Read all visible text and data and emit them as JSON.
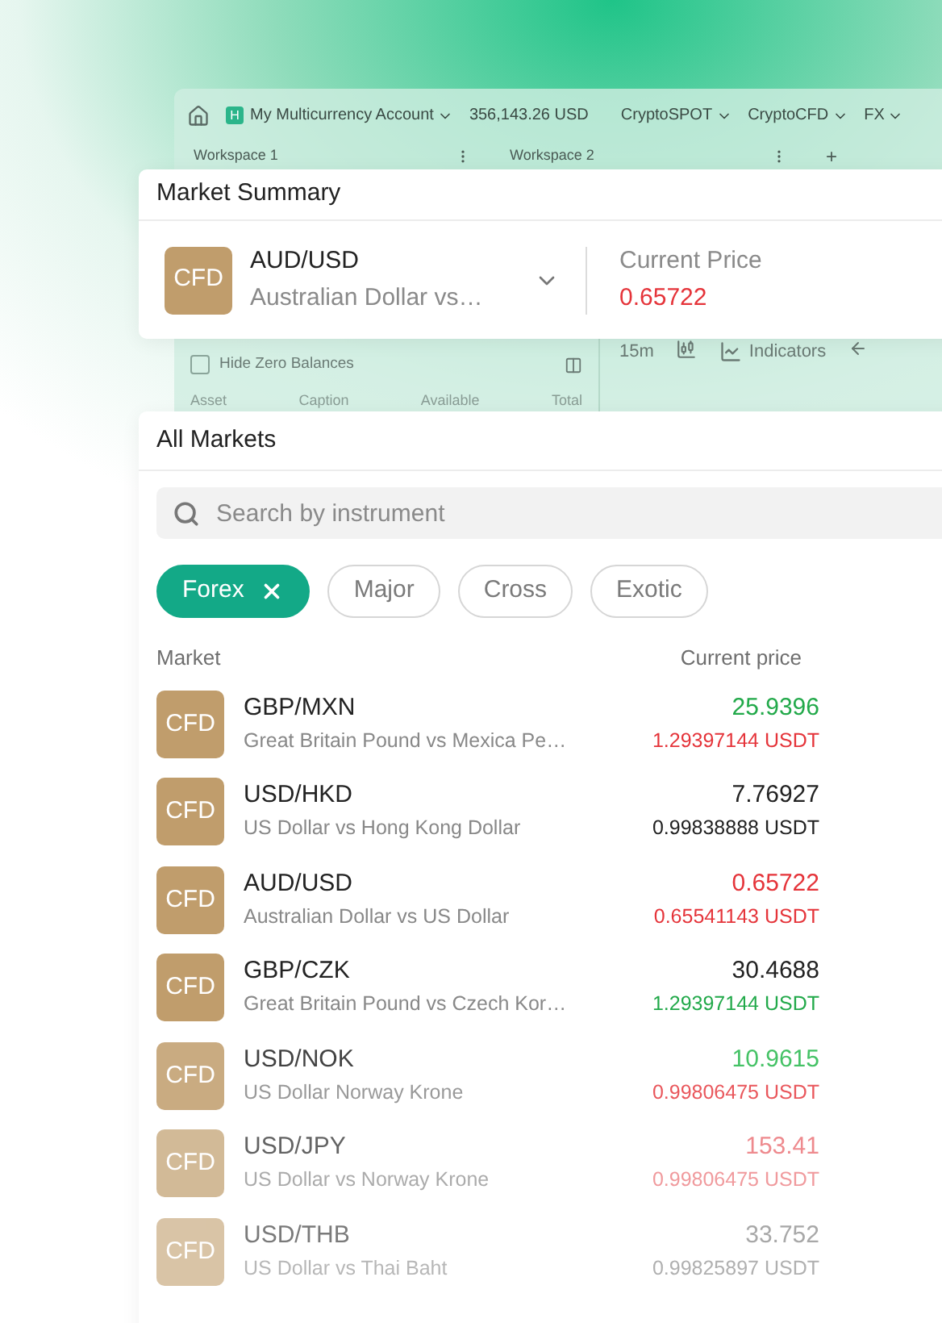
{
  "app_toolbar": {
    "account_badge": "H",
    "account": "My Multicurrency Account",
    "balance": "356,143.26 USD",
    "menus": [
      "CryptoSPOT",
      "CryptoCFD",
      "FX"
    ]
  },
  "workspace_tabs": [
    {
      "label": "Workspace 1"
    },
    {
      "label": "Workspace 2"
    }
  ],
  "add_tab": "+",
  "balances_panel": {
    "hide_zero_balances": {
      "label": "Hide Zero Balances",
      "checked": false
    },
    "columns": [
      "Asset",
      "Caption",
      "Available",
      "Total"
    ]
  },
  "chart_toolbar": {
    "interval": "15m",
    "indicators": "Indicators"
  },
  "market_summary": {
    "title": "Market Summary",
    "badge": "CFD",
    "symbol": "AUD/USD",
    "description": "Australian Dollar vs…",
    "price_label": "Current Price",
    "price": {
      "text": "0.65722",
      "color": "#e5343a"
    }
  },
  "all_markets": {
    "title": "All Markets",
    "search": {
      "placeholder": "Search by instrument"
    },
    "filters": [
      {
        "label": "Forex",
        "selected": true
      },
      {
        "label": "Major",
        "selected": false
      },
      {
        "label": "Cross",
        "selected": false
      },
      {
        "label": "Exotic",
        "selected": false
      }
    ],
    "columns": [
      "Market",
      "Current price"
    ],
    "rows": [
      {
        "badge": "CFD",
        "symbol": "GBP/MXN",
        "description": "Great Britain Pound vs Mexica Pe…",
        "price": {
          "text": "25.9396",
          "color": "#22a94a"
        },
        "usdt": {
          "text": "1.29397144 USDT",
          "color": "#e5343a"
        }
      },
      {
        "badge": "CFD",
        "symbol": "USD/HKD",
        "description": "US Dollar vs Hong Kong Dollar",
        "price": {
          "text": "7.76927",
          "color": "#222222"
        },
        "usdt": {
          "text": "0.99838888 USDT",
          "color": "#222222"
        }
      },
      {
        "badge": "CFD",
        "symbol": "AUD/USD",
        "description": "Australian Dollar vs US Dollar",
        "price": {
          "text": "0.65722",
          "color": "#e5343a"
        },
        "usdt": {
          "text": "0.65541143 USDT",
          "color": "#e5343a"
        }
      },
      {
        "badge": "CFD",
        "symbol": "GBP/CZK",
        "description": "Great Britain Pound vs Czech Kor…",
        "price": {
          "text": "30.4688",
          "color": "#222222"
        },
        "usdt": {
          "text": "1.29397144 USDT",
          "color": "#22a94a"
        }
      },
      {
        "badge": "CFD",
        "symbol": "USD/NOK",
        "description": "US Dollar Norway Krone",
        "price": {
          "text": "10.9615",
          "color": "#45c266"
        },
        "usdt": {
          "text": "0.99806475 USDT",
          "color": "#e9575c"
        }
      },
      {
        "badge": "CFD",
        "symbol": "USD/JPY",
        "description": "US Dollar vs Norway Krone",
        "price": {
          "text": "153.41",
          "color": "#ee8a8e"
        },
        "usdt": {
          "text": "0.99806475 USDT",
          "color": "#f09a9d"
        }
      },
      {
        "badge": "CFD",
        "symbol": "USD/THB",
        "description": "US Dollar vs Thai Baht",
        "price": {
          "text": "33.752",
          "color": "#a8a8a8"
        },
        "usdt": {
          "text": "0.99825897 USDT",
          "color": "#b0b0b0"
        }
      }
    ]
  }
}
